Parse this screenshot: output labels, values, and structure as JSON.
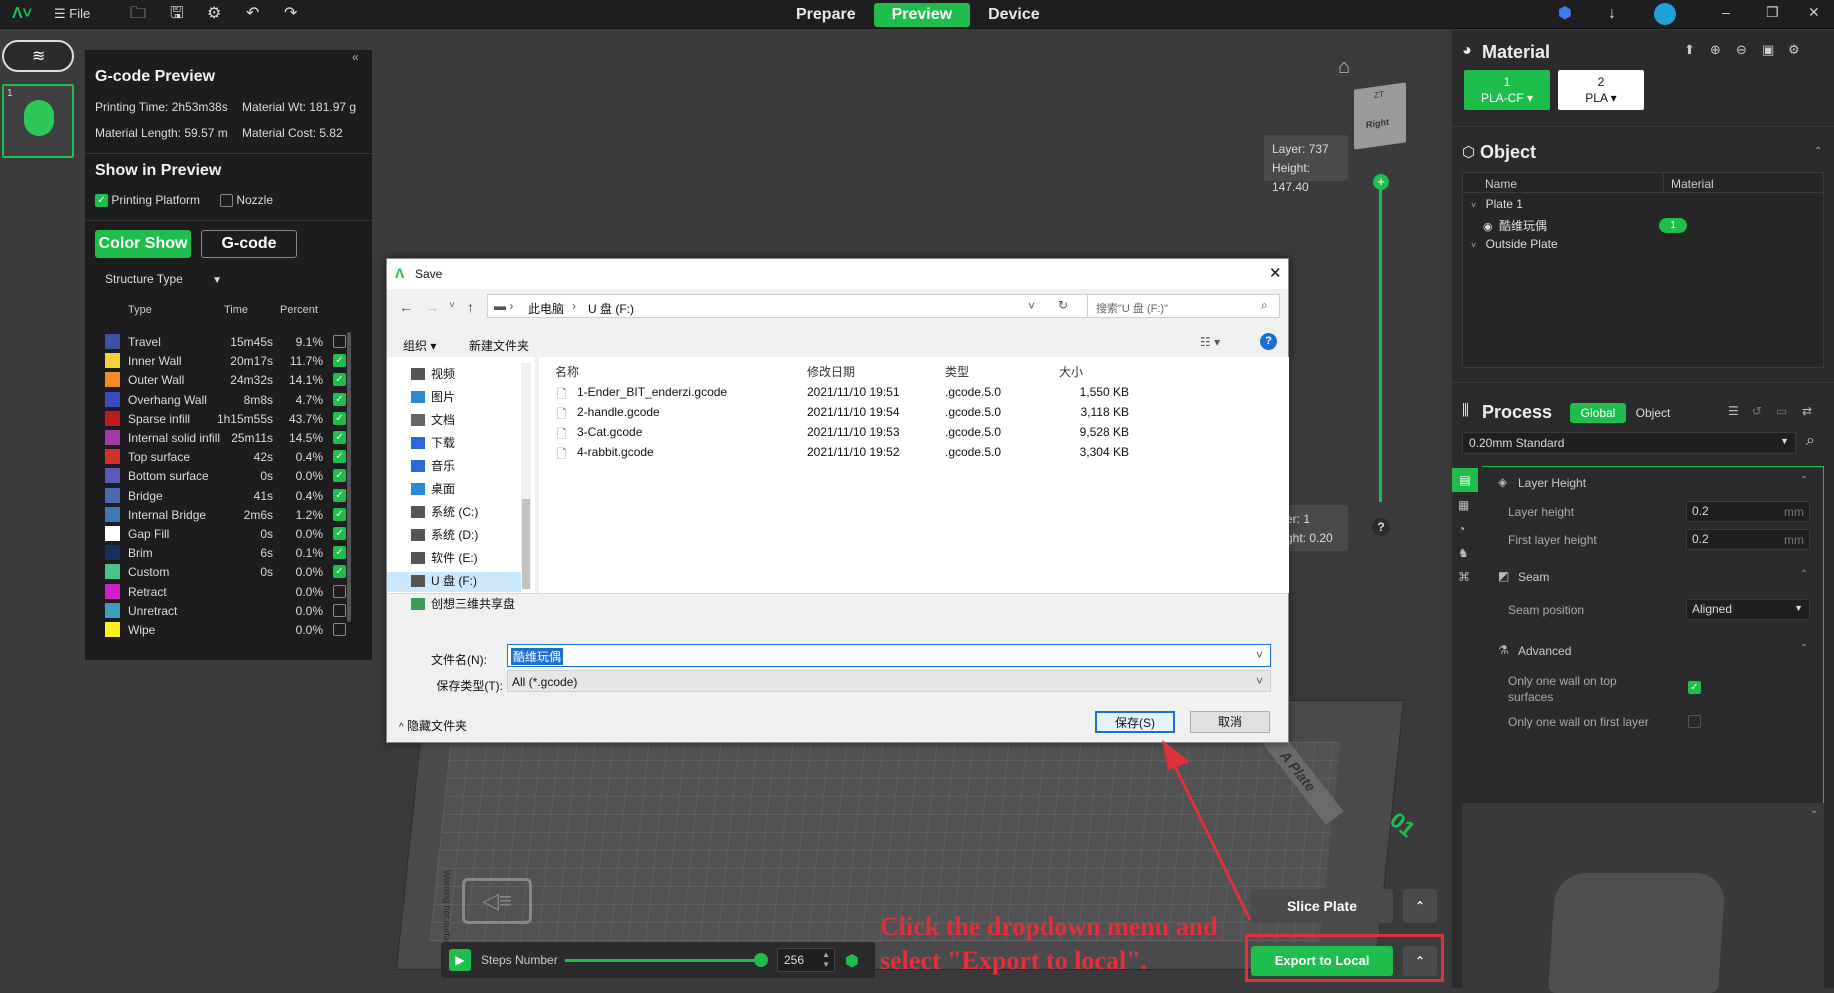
{
  "topbar": {
    "file_label": "File",
    "tabs": [
      "Prepare",
      "Preview",
      "Device"
    ],
    "active_tab": "Preview"
  },
  "gcode": {
    "title": "G-code Preview",
    "printing_time": "Printing Time: 2h53m38s",
    "material_wt": "Material Wt: 181.97 g",
    "material_length": "Material Length: 59.57 m",
    "material_cost": "Material Cost: 5.82",
    "show_title": "Show in Preview",
    "printing_platform": "Printing Platform",
    "nozzle": "Nozzle",
    "color_show": "Color Show",
    "gcode_btn": "G-code",
    "structure_type": "Structure Type",
    "col_type": "Type",
    "col_time": "Time",
    "col_percent": "Percent",
    "rows": [
      {
        "name": "Travel",
        "time": "15m45s",
        "pct": "9.1%",
        "color": "#3a52a8",
        "checked": false
      },
      {
        "name": "Inner Wall",
        "time": "20m17s",
        "pct": "11.7%",
        "color": "#f5d23a",
        "checked": true
      },
      {
        "name": "Outer Wall",
        "time": "24m32s",
        "pct": "14.1%",
        "color": "#f28c28",
        "checked": true
      },
      {
        "name": "Overhang Wall",
        "time": "8m8s",
        "pct": "4.7%",
        "color": "#3c4ac0",
        "checked": true
      },
      {
        "name": "Sparse infill",
        "time": "1h15m55s",
        "pct": "43.7%",
        "color": "#b81d1d",
        "checked": true
      },
      {
        "name": "Internal solid infill",
        "time": "25m11s",
        "pct": "14.5%",
        "color": "#a23aa8",
        "checked": true
      },
      {
        "name": "Top surface",
        "time": "42s",
        "pct": "0.4%",
        "color": "#d2302c",
        "checked": true
      },
      {
        "name": "Bottom surface",
        "time": "0s",
        "pct": "0.0%",
        "color": "#5a5ab8",
        "checked": true
      },
      {
        "name": "Bridge",
        "time": "41s",
        "pct": "0.4%",
        "color": "#4a6ab0",
        "checked": true
      },
      {
        "name": "Internal Bridge",
        "time": "2m6s",
        "pct": "1.2%",
        "color": "#3f79b5",
        "checked": true
      },
      {
        "name": "Gap Fill",
        "time": "0s",
        "pct": "0.0%",
        "color": "#ffffff",
        "checked": true
      },
      {
        "name": "Brim",
        "time": "6s",
        "pct": "0.1%",
        "color": "#15305a",
        "checked": true
      },
      {
        "name": "Custom",
        "time": "0s",
        "pct": "0.0%",
        "color": "#4ac28a",
        "checked": true
      },
      {
        "name": "Retract",
        "time": "",
        "pct": "0.0%",
        "color": "#d21ec8",
        "checked": false
      },
      {
        "name": "Unretract",
        "time": "",
        "pct": "0.0%",
        "color": "#3aa0b8",
        "checked": false
      },
      {
        "name": "Wipe",
        "time": "",
        "pct": "0.0%",
        "color": "#f5f01e",
        "checked": false
      }
    ]
  },
  "viewport": {
    "cube_top": "ZT",
    "cube_face": "Right",
    "layer_top": "Layer: 737",
    "height_top": "Height: 147.40",
    "layer_bottom": "er: 1",
    "height_bottom": "ght: 0.20",
    "help": "?",
    "plate_label": "A Plate",
    "plate_num": "01",
    "warning_text": "Warning hot surface",
    "steps_label": "Steps Number",
    "steps_value": "256",
    "slice_plate": "Slice Plate",
    "export_local": "Export to Local",
    "annotation_line1": "Click the dropdown menu and",
    "annotation_line2": "select \"Export to local\"."
  },
  "material": {
    "title": "Material",
    "slot1_num": "1",
    "slot1_name": "PLA-CF",
    "slot2_num": "2",
    "slot2_name": "PLA"
  },
  "object": {
    "title": "Object",
    "col_name": "Name",
    "col_material": "Material",
    "plate": "Plate 1",
    "item": "酷维玩偶",
    "item_material": "1",
    "outside": "Outside Plate"
  },
  "process": {
    "title": "Process",
    "global": "Global",
    "object": "Object",
    "preset": "0.20mm Standard",
    "layer_height_group": "Layer Height",
    "layer_height_label": "Layer height",
    "layer_height_value": "0.2",
    "first_layer_label": "First layer height",
    "first_layer_value": "0.2",
    "unit": "mm",
    "seam_group": "Seam",
    "seam_position_label": "Seam position",
    "seam_position_value": "Aligned",
    "advanced_group": "Advanced",
    "one_wall_top": "Only one wall on top surfaces",
    "one_wall_first": "Only one wall on first layer"
  },
  "dialog": {
    "title": "Save",
    "path_root": "此电脑",
    "path_drive": "U 盘 (F:)",
    "search_placeholder": "搜索\"U 盘 (F:)\"",
    "organize": "组织 ▾",
    "new_folder": "新建文件夹",
    "tree": [
      "视频",
      "图片",
      "文档",
      "下载",
      "音乐",
      "桌面",
      "系统 (C:)",
      "系统 (D:)",
      "软件 (E:)",
      "U 盘 (F:)",
      "创想三维共享盘"
    ],
    "col_name": "名称",
    "col_date": "修改日期",
    "col_type": "类型",
    "col_size": "大小",
    "files": [
      {
        "name": "1-Ender_BIT_enderzi.gcode",
        "date": "2021/11/10 19:51",
        "type": ".gcode.5.0",
        "size": "1,550 KB"
      },
      {
        "name": "2-handle.gcode",
        "date": "2021/11/10 19:54",
        "type": ".gcode.5.0",
        "size": "3,118 KB"
      },
      {
        "name": "3-Cat.gcode",
        "date": "2021/11/10 19:53",
        "type": ".gcode.5.0",
        "size": "9,528 KB"
      },
      {
        "name": "4-rabbit.gcode",
        "date": "2021/11/10 19:52",
        "type": ".gcode.5.0",
        "size": "3,304 KB"
      }
    ],
    "filename_label": "文件名(N):",
    "filename_value": "酷维玩偶",
    "filetype_label": "保存类型(T):",
    "filetype_value": "All (*.gcode)",
    "hide_folders": "隐藏文件夹",
    "save_btn": "保存(S)",
    "cancel_btn": "取消"
  },
  "colors": {
    "accent": "#1fbe4c",
    "annotation": "#e0303a"
  }
}
